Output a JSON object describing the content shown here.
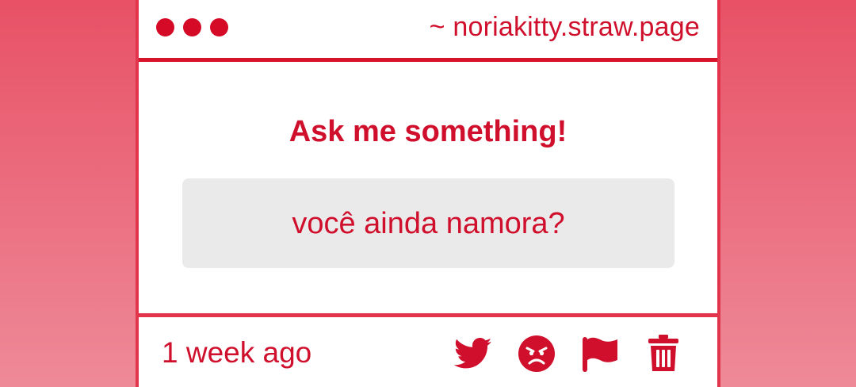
{
  "colors": {
    "accent": "#cf0f2b",
    "border": "#e2344a",
    "question_bg": "#ebeaeb",
    "background_top": "#e85166",
    "background_bottom": "#ee8a98"
  },
  "titlebar": {
    "site_url": "~ noriakitty.straw.page",
    "window_dots": [
      "dot",
      "dot",
      "dot"
    ]
  },
  "content": {
    "heading": "Ask me something!",
    "question": "você ainda namora?"
  },
  "footer": {
    "timestamp": "1 week ago",
    "actions": [
      {
        "icon": "twitter-icon"
      },
      {
        "icon": "angry-face-icon"
      },
      {
        "icon": "flag-icon"
      },
      {
        "icon": "trash-icon"
      }
    ]
  }
}
